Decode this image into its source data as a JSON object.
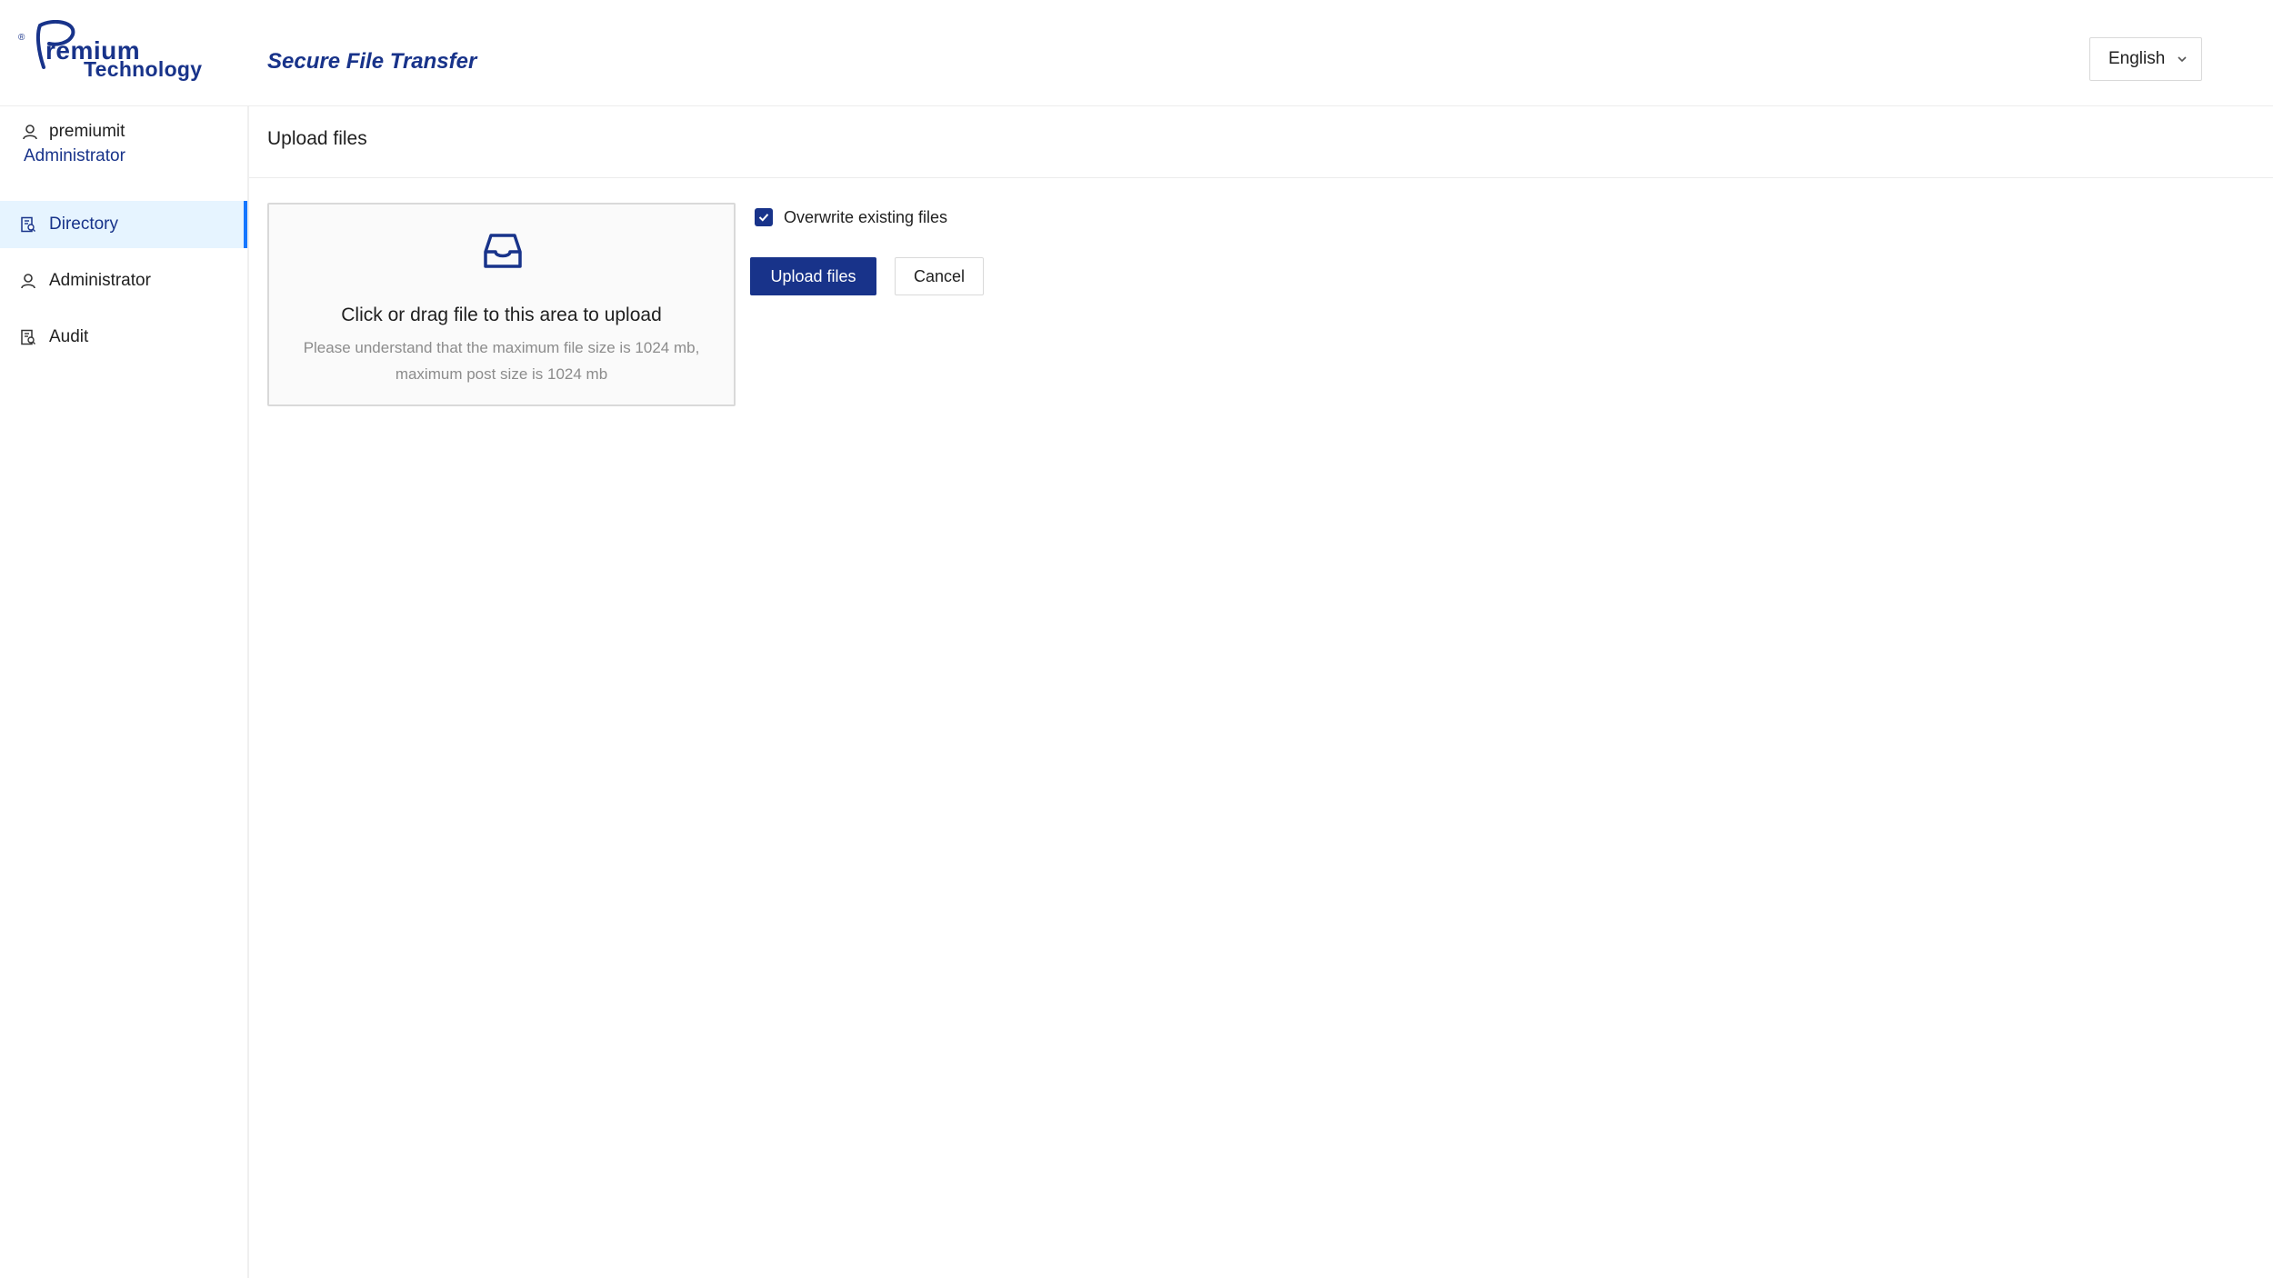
{
  "header": {
    "logo": {
      "reg_mark": "®",
      "line1": "remium",
      "line2": "Technology"
    },
    "app_title": "Secure File Transfer",
    "language": {
      "selected": "English",
      "icon": "chevron-down-icon"
    }
  },
  "sidebar": {
    "user": {
      "name": "premiumit",
      "role": "Administrator",
      "icon": "user-icon"
    },
    "items": [
      {
        "label": "Directory",
        "icon": "directory-icon",
        "active": true
      },
      {
        "label": "Administrator",
        "icon": "user-icon",
        "active": false
      },
      {
        "label": "Audit",
        "icon": "audit-icon",
        "active": false
      }
    ]
  },
  "main": {
    "title": "Upload files",
    "dropzone": {
      "icon": "inbox-icon",
      "title": "Click or drag file to this area to upload",
      "hint_line1": "Please understand that the maximum file size is 1024 mb,",
      "hint_line2": "maximum post size is 1024 mb"
    },
    "overwrite": {
      "label": "Overwrite existing files",
      "checked": true
    },
    "buttons": {
      "upload": "Upload files",
      "cancel": "Cancel"
    }
  },
  "colors": {
    "brand": "#18338a",
    "active_bg": "#e6f4ff",
    "active_border": "#1677ff",
    "muted_text": "#8c8c8c",
    "border": "#d9d9d9"
  }
}
